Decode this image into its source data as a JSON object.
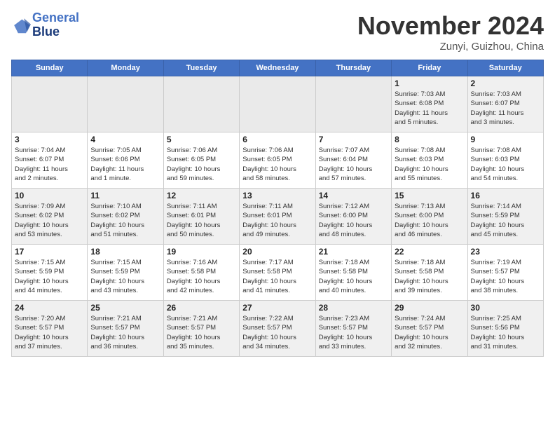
{
  "header": {
    "logo_line1": "General",
    "logo_line2": "Blue",
    "month": "November 2024",
    "location": "Zunyi, Guizhou, China"
  },
  "weekdays": [
    "Sunday",
    "Monday",
    "Tuesday",
    "Wednesday",
    "Thursday",
    "Friday",
    "Saturday"
  ],
  "weeks": [
    [
      {
        "day": "",
        "info": ""
      },
      {
        "day": "",
        "info": ""
      },
      {
        "day": "",
        "info": ""
      },
      {
        "day": "",
        "info": ""
      },
      {
        "day": "",
        "info": ""
      },
      {
        "day": "1",
        "info": "Sunrise: 7:03 AM\nSunset: 6:08 PM\nDaylight: 11 hours\nand 5 minutes."
      },
      {
        "day": "2",
        "info": "Sunrise: 7:03 AM\nSunset: 6:07 PM\nDaylight: 11 hours\nand 3 minutes."
      }
    ],
    [
      {
        "day": "3",
        "info": "Sunrise: 7:04 AM\nSunset: 6:07 PM\nDaylight: 11 hours\nand 2 minutes."
      },
      {
        "day": "4",
        "info": "Sunrise: 7:05 AM\nSunset: 6:06 PM\nDaylight: 11 hours\nand 1 minute."
      },
      {
        "day": "5",
        "info": "Sunrise: 7:06 AM\nSunset: 6:05 PM\nDaylight: 10 hours\nand 59 minutes."
      },
      {
        "day": "6",
        "info": "Sunrise: 7:06 AM\nSunset: 6:05 PM\nDaylight: 10 hours\nand 58 minutes."
      },
      {
        "day": "7",
        "info": "Sunrise: 7:07 AM\nSunset: 6:04 PM\nDaylight: 10 hours\nand 57 minutes."
      },
      {
        "day": "8",
        "info": "Sunrise: 7:08 AM\nSunset: 6:03 PM\nDaylight: 10 hours\nand 55 minutes."
      },
      {
        "day": "9",
        "info": "Sunrise: 7:08 AM\nSunset: 6:03 PM\nDaylight: 10 hours\nand 54 minutes."
      }
    ],
    [
      {
        "day": "10",
        "info": "Sunrise: 7:09 AM\nSunset: 6:02 PM\nDaylight: 10 hours\nand 53 minutes."
      },
      {
        "day": "11",
        "info": "Sunrise: 7:10 AM\nSunset: 6:02 PM\nDaylight: 10 hours\nand 51 minutes."
      },
      {
        "day": "12",
        "info": "Sunrise: 7:11 AM\nSunset: 6:01 PM\nDaylight: 10 hours\nand 50 minutes."
      },
      {
        "day": "13",
        "info": "Sunrise: 7:11 AM\nSunset: 6:01 PM\nDaylight: 10 hours\nand 49 minutes."
      },
      {
        "day": "14",
        "info": "Sunrise: 7:12 AM\nSunset: 6:00 PM\nDaylight: 10 hours\nand 48 minutes."
      },
      {
        "day": "15",
        "info": "Sunrise: 7:13 AM\nSunset: 6:00 PM\nDaylight: 10 hours\nand 46 minutes."
      },
      {
        "day": "16",
        "info": "Sunrise: 7:14 AM\nSunset: 5:59 PM\nDaylight: 10 hours\nand 45 minutes."
      }
    ],
    [
      {
        "day": "17",
        "info": "Sunrise: 7:15 AM\nSunset: 5:59 PM\nDaylight: 10 hours\nand 44 minutes."
      },
      {
        "day": "18",
        "info": "Sunrise: 7:15 AM\nSunset: 5:59 PM\nDaylight: 10 hours\nand 43 minutes."
      },
      {
        "day": "19",
        "info": "Sunrise: 7:16 AM\nSunset: 5:58 PM\nDaylight: 10 hours\nand 42 minutes."
      },
      {
        "day": "20",
        "info": "Sunrise: 7:17 AM\nSunset: 5:58 PM\nDaylight: 10 hours\nand 41 minutes."
      },
      {
        "day": "21",
        "info": "Sunrise: 7:18 AM\nSunset: 5:58 PM\nDaylight: 10 hours\nand 40 minutes."
      },
      {
        "day": "22",
        "info": "Sunrise: 7:18 AM\nSunset: 5:58 PM\nDaylight: 10 hours\nand 39 minutes."
      },
      {
        "day": "23",
        "info": "Sunrise: 7:19 AM\nSunset: 5:57 PM\nDaylight: 10 hours\nand 38 minutes."
      }
    ],
    [
      {
        "day": "24",
        "info": "Sunrise: 7:20 AM\nSunset: 5:57 PM\nDaylight: 10 hours\nand 37 minutes."
      },
      {
        "day": "25",
        "info": "Sunrise: 7:21 AM\nSunset: 5:57 PM\nDaylight: 10 hours\nand 36 minutes."
      },
      {
        "day": "26",
        "info": "Sunrise: 7:21 AM\nSunset: 5:57 PM\nDaylight: 10 hours\nand 35 minutes."
      },
      {
        "day": "27",
        "info": "Sunrise: 7:22 AM\nSunset: 5:57 PM\nDaylight: 10 hours\nand 34 minutes."
      },
      {
        "day": "28",
        "info": "Sunrise: 7:23 AM\nSunset: 5:57 PM\nDaylight: 10 hours\nand 33 minutes."
      },
      {
        "day": "29",
        "info": "Sunrise: 7:24 AM\nSunset: 5:57 PM\nDaylight: 10 hours\nand 32 minutes."
      },
      {
        "day": "30",
        "info": "Sunrise: 7:25 AM\nSunset: 5:56 PM\nDaylight: 10 hours\nand 31 minutes."
      }
    ]
  ]
}
